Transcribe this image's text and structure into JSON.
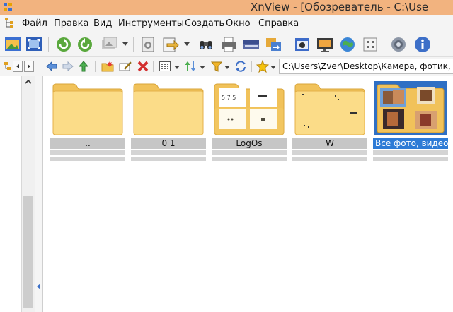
{
  "window": {
    "title": "XnView - [Обозреватель - C:\\Use"
  },
  "menu": [
    "Файл",
    "Правка",
    "Вид",
    "Инструменты",
    "Создать",
    "Окно",
    "Справка"
  ],
  "address": {
    "path": "C:\\Users\\Zver\\Desktop\\Камера, фотик, тел"
  },
  "items": [
    {
      "name": "..",
      "type": "parent-folder"
    },
    {
      "name": "0 1",
      "type": "folder"
    },
    {
      "name": "LogOs",
      "type": "folder-with-thumbs"
    },
    {
      "name": "W",
      "type": "folder-with-thumbs"
    },
    {
      "name": "Все фото, видео...",
      "type": "folder-with-photos",
      "selected": true
    }
  ]
}
